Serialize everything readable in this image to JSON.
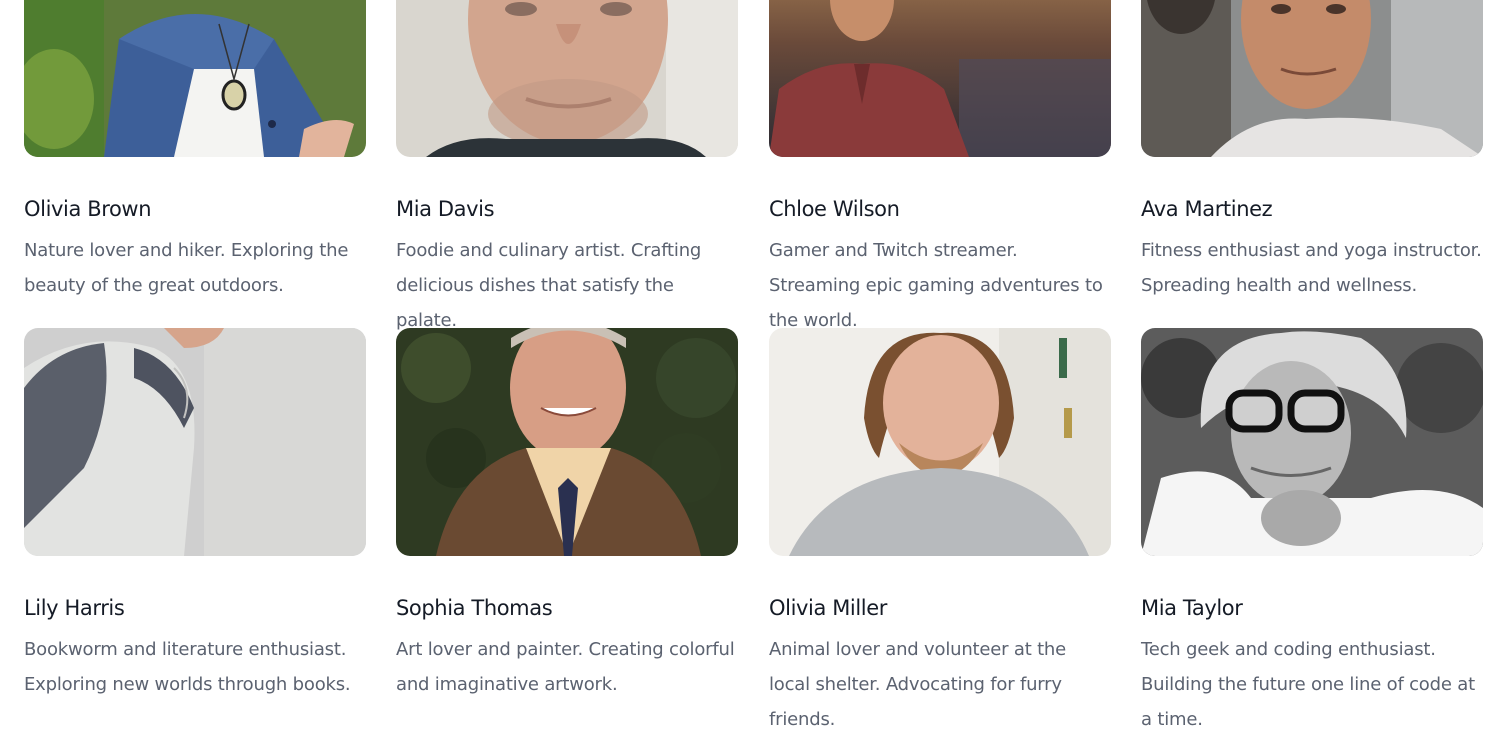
{
  "people": [
    {
      "name": "Olivia Brown",
      "bio": "Nature lover and hiker. Exploring the beauty of the great outdoors.",
      "photo_icon": "portrait-woman-denim-jacket"
    },
    {
      "name": "Mia Davis",
      "bio": "Foodie and culinary artist. Crafting delicious dishes that satisfy the palate.",
      "photo_icon": "portrait-man-closeup-smile"
    },
    {
      "name": "Chloe Wilson",
      "bio": "Gamer and Twitch streamer. Streaming epic gaming adventures to the world.",
      "photo_icon": "portrait-man-red-shirt"
    },
    {
      "name": "Ava Martinez",
      "bio": "Fitness enthusiast and yoga instructor. Spreading health and wellness.",
      "photo_icon": "portrait-man-grey-tshirt"
    },
    {
      "name": "Lily Harris",
      "bio": "Bookworm and literature enthusiast. Exploring new worlds through books.",
      "photo_icon": "portrait-man-raglan-shirt"
    },
    {
      "name": "Sophia Thomas",
      "bio": "Art lover and painter. Creating colorful and imaginative artwork.",
      "photo_icon": "portrait-man-tweed-jacket"
    },
    {
      "name": "Olivia Miller",
      "bio": "Animal lover and volunteer at the local shelter. Advocating for furry friends.",
      "photo_icon": "portrait-man-grey-sweater"
    },
    {
      "name": "Mia Taylor",
      "bio": "Tech geek and coding enthusiast. Building the future one line of code at a time.",
      "photo_icon": "portrait-man-glasses-bw"
    }
  ]
}
